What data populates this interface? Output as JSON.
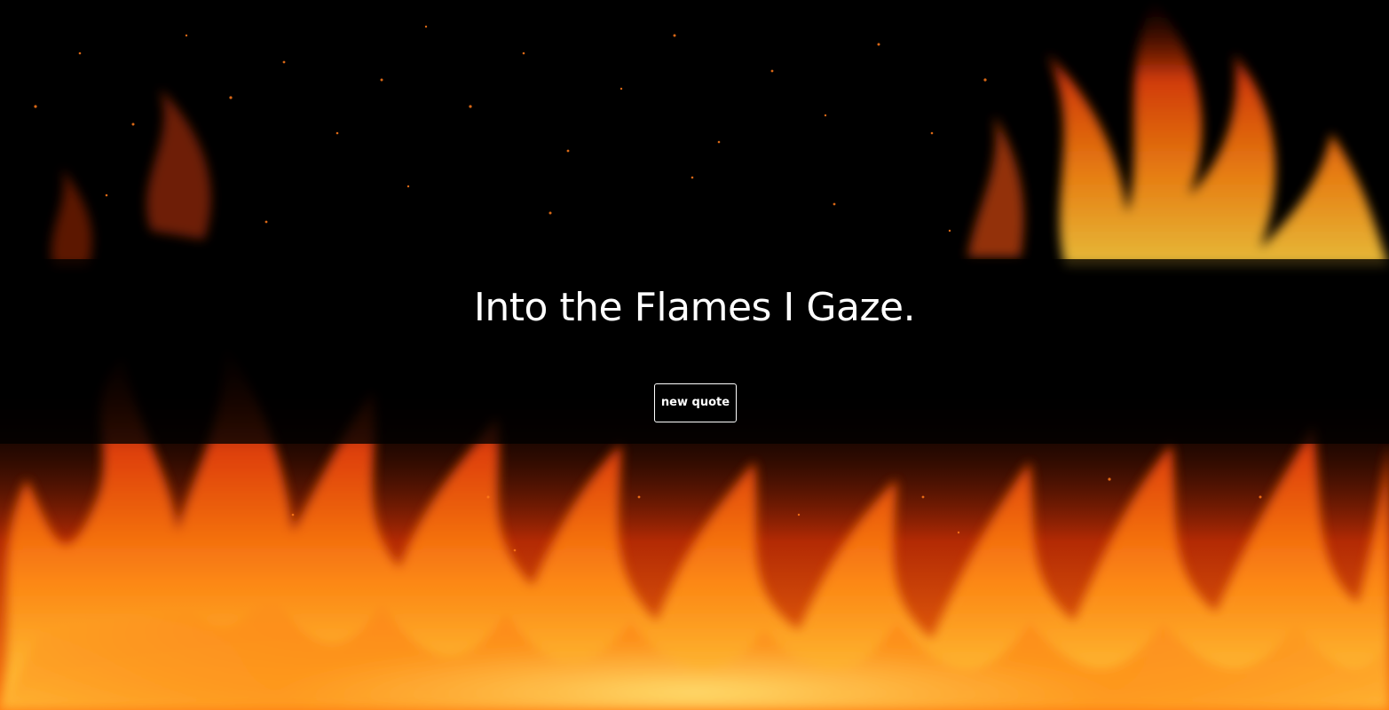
{
  "quote": {
    "text": "Into the Flames I Gaze."
  },
  "button": {
    "label": "new quote"
  },
  "colors": {
    "background": "#000000",
    "flame_deep": "#8a1800",
    "flame_mid": "#ff5a0a",
    "flame_bright": "#ffb020",
    "text": "#ffffff"
  }
}
